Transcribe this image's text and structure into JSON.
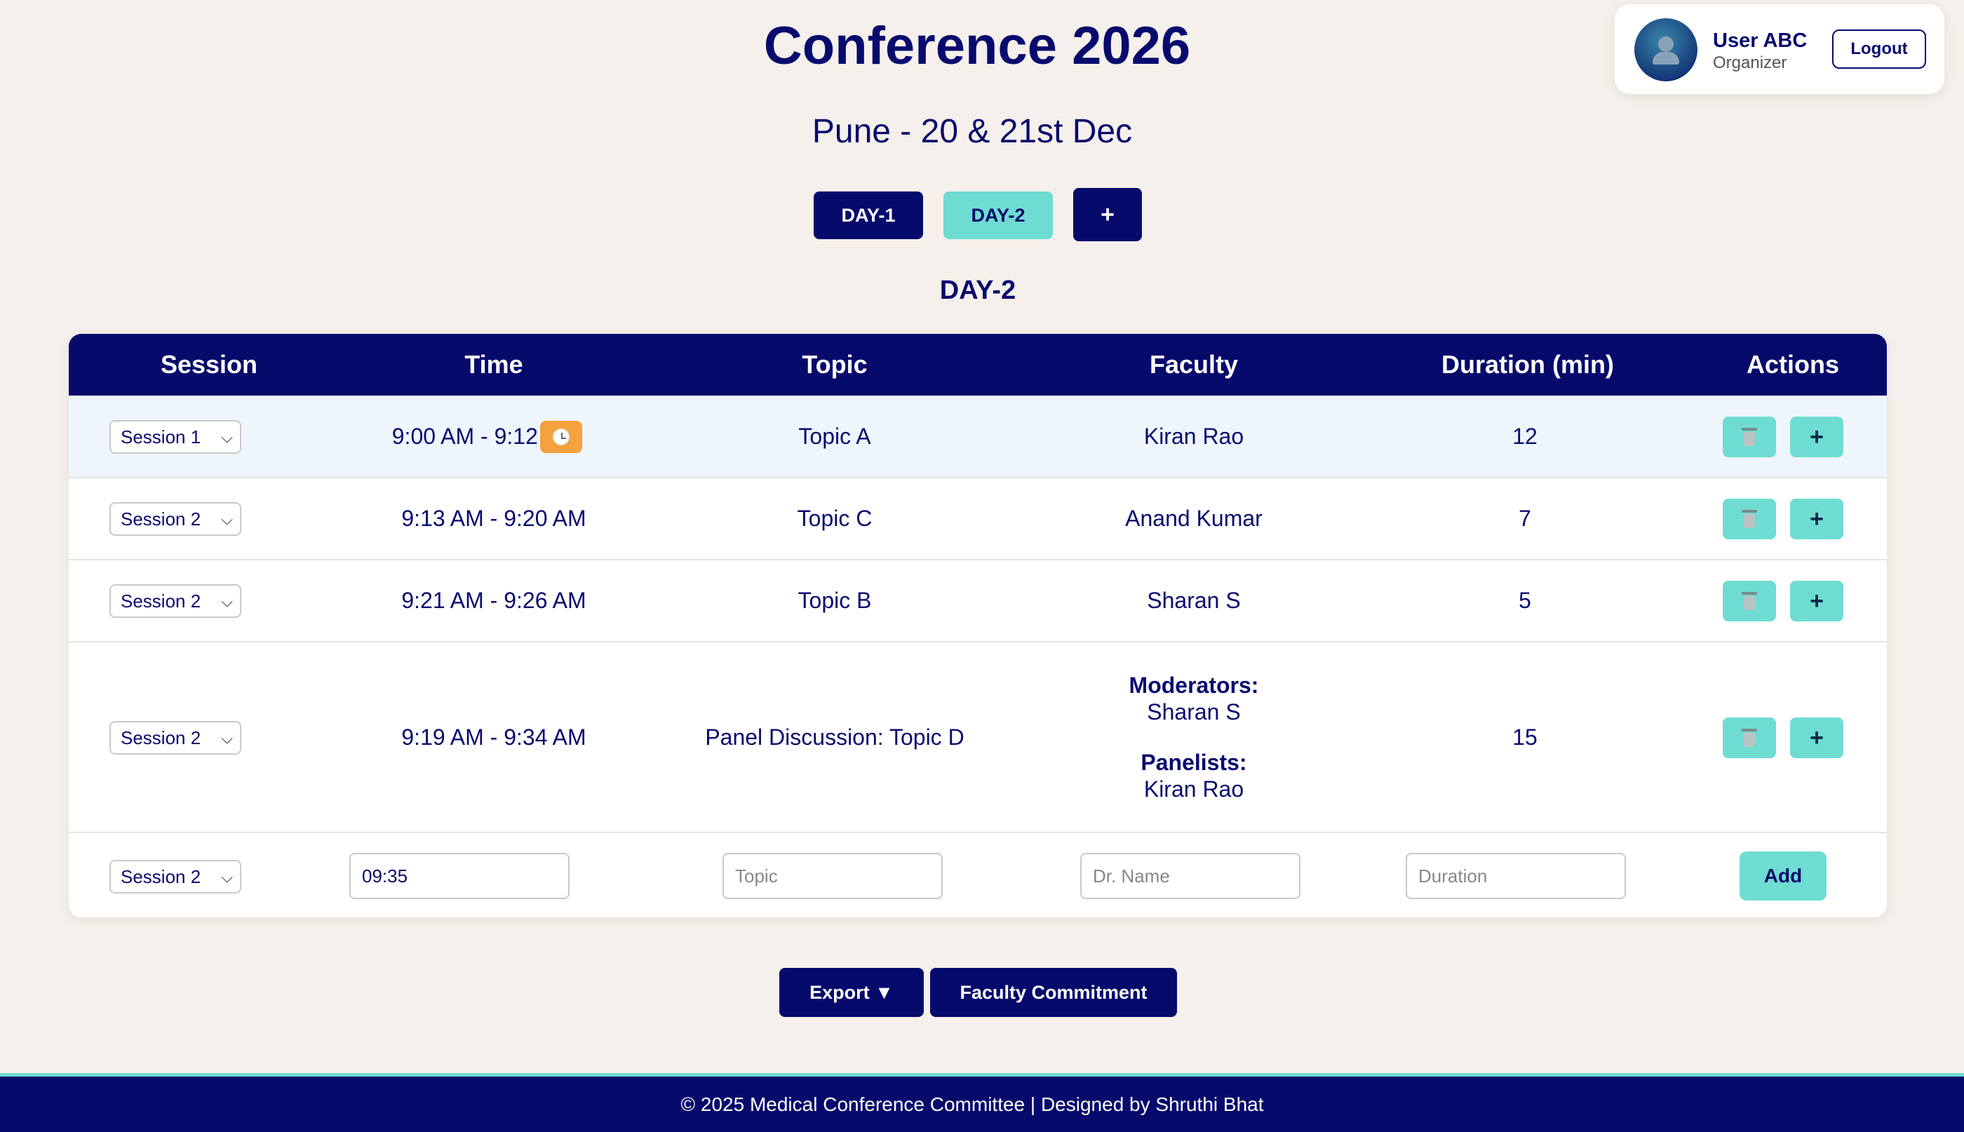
{
  "header": {
    "title": "Conference 2026",
    "subtitle": "Pune - 20 & 21st Dec"
  },
  "user": {
    "name": "User ABC",
    "role": "Organizer",
    "logout_label": "Logout"
  },
  "day_tabs": {
    "items": [
      {
        "label": "DAY-1",
        "active": false
      },
      {
        "label": "DAY-2",
        "active": true
      }
    ],
    "add_label": "+"
  },
  "day_heading": "DAY-2",
  "table": {
    "columns": [
      "Session",
      "Time",
      "Topic",
      "Faculty",
      "Duration (min)",
      "Actions"
    ],
    "rows": [
      {
        "session": "Session 1",
        "time": "9:00 AM - 9:12 AM",
        "topic": "Topic A",
        "faculty": "Kiran Rao",
        "duration": "12",
        "has_clock": true
      },
      {
        "session": "Session 2",
        "time": "9:13 AM - 9:20 AM",
        "topic": "Topic C",
        "faculty": "Anand Kumar",
        "duration": "7"
      },
      {
        "session": "Session 2",
        "time": "9:21 AM - 9:26 AM",
        "topic": "Topic B",
        "faculty": "Sharan S",
        "duration": "5"
      },
      {
        "session": "Session 2",
        "time": "9:19 AM - 9:34 AM",
        "topic": "Panel Discussion: Topic D",
        "moderators_label": "Moderators:",
        "moderators": "Sharan S",
        "panelists_label": "Panelists:",
        "panelists": "Kiran Rao",
        "duration": "15"
      }
    ],
    "add_row": {
      "session": "Session 2",
      "time_value": "09:35",
      "topic_placeholder": "Topic",
      "faculty_placeholder": "Dr. Name",
      "duration_placeholder": "Duration",
      "add_label": "Add"
    },
    "action_add_label": "+"
  },
  "buttons": {
    "export_label": "Export ▼",
    "faculty_commitment_label": "Faculty Commitment"
  },
  "footer": {
    "text": "© 2025 Medical Conference Committee | Designed by Shruthi Bhat"
  },
  "colors": {
    "primary": "#060a6b",
    "accent": "#6fdcd2",
    "clock": "#f4a23e",
    "background": "#f5f0eb"
  }
}
